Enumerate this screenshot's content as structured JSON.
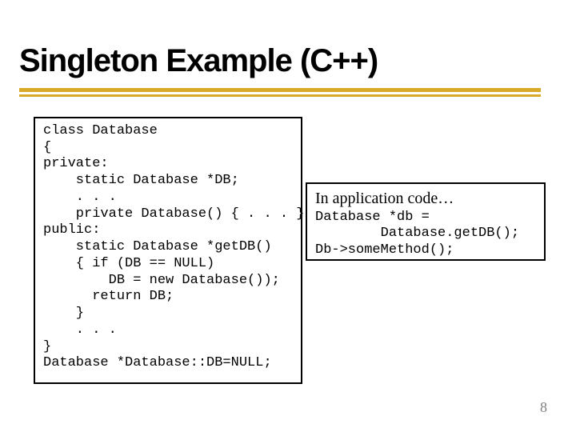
{
  "title": "Singleton Example (C++)",
  "left_code": "class Database\n{\nprivate:\n    static Database *DB;\n    . . .\n    private Database() { . . . }\npublic:\n    static Database *getDB()\n    { if (DB == NULL)\n        DB = new Database());\n      return DB;\n    }\n    . . .\n}\nDatabase *Database::DB=NULL;",
  "right_intro": "In application code…",
  "right_code": "Database *db =\n        Database.getDB();\nDb->someMethod();",
  "page_number": "8"
}
